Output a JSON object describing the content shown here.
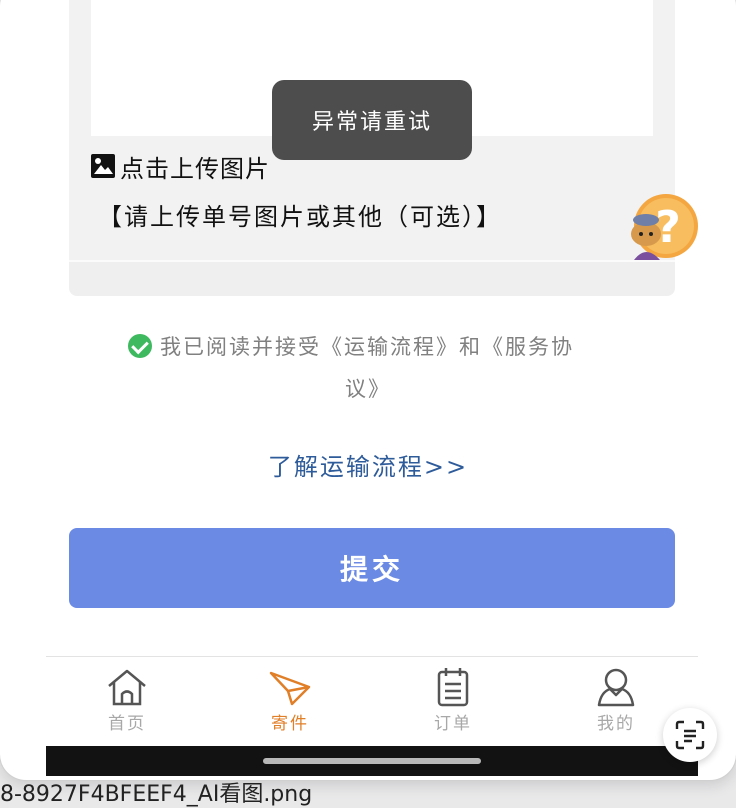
{
  "upload": {
    "label": "点击上传图片",
    "hint": "【请上传单号图片或其他（可选）】"
  },
  "toast": {
    "message": "异常请重试"
  },
  "agreement": {
    "text_line1": "我已阅读并接受《运输流程》和《服务协",
    "text_line2": "议》",
    "checked": true
  },
  "learn_more": {
    "label": "了解运输流程>>"
  },
  "submit": {
    "label": "提交"
  },
  "tabbar": {
    "tabs": [
      {
        "label": "首页",
        "icon": "home-icon",
        "active": false
      },
      {
        "label": "寄件",
        "icon": "paper-plane-icon",
        "active": true
      },
      {
        "label": "订单",
        "icon": "order-list-icon",
        "active": false
      },
      {
        "label": "我的",
        "icon": "user-icon",
        "active": false
      }
    ]
  },
  "finder": {
    "filename": "8-8927F4BFEEF4_AI看图.png"
  },
  "colors": {
    "accent_active": "#e07f28",
    "submit_bg": "#6b8ae4",
    "link": "#2e5b9a",
    "check_green": "#3fb960",
    "toast_bg": "#4d4d4d"
  }
}
